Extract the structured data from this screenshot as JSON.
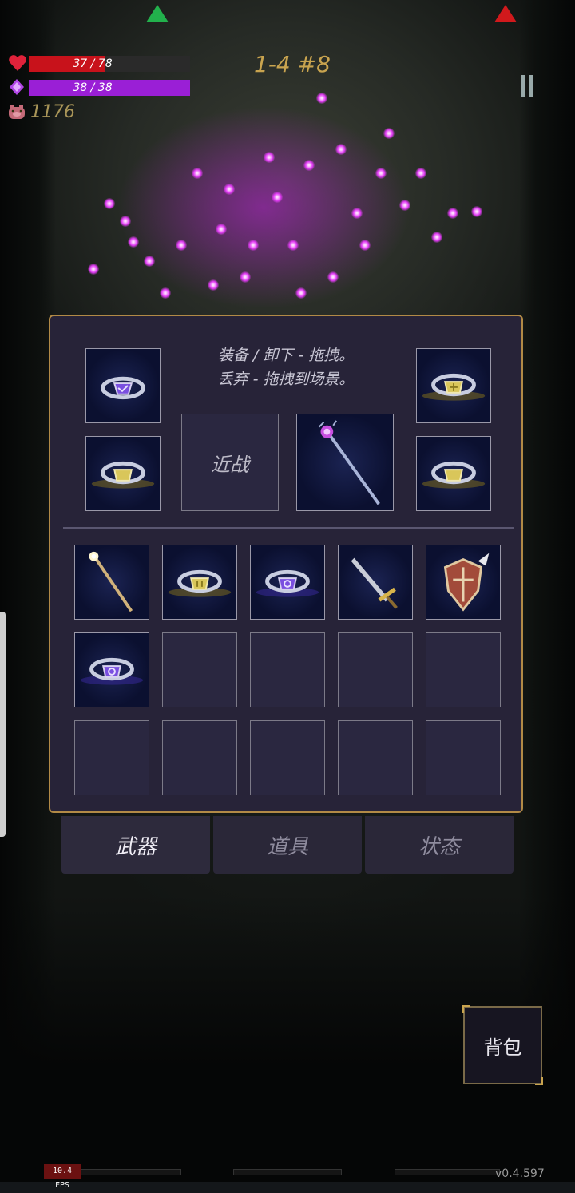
{
  "hud": {
    "hp_text": "37 / 78",
    "hp_fraction": 0.474,
    "mp_text": "38 / 38",
    "mp_fraction": 1.0,
    "coins": "1176",
    "stage": "1-4 #8",
    "colors": {
      "hp": "#c8121b",
      "mp": "#9a1fd6",
      "accent": "#c9a44f"
    }
  },
  "inventory": {
    "hint_line1": "装备 / 卸下 - 拖拽。",
    "hint_line2": "丢弃 - 拖拽到场景。",
    "melee_label": "近战",
    "equipped": {
      "ring_top_left": "ring-purple-icon",
      "ring_bottom_left": "ring-gold-icon",
      "weapon": "staff-icon",
      "ring_top_right": "ring-gold-icon",
      "ring_bottom_right": "ring-gold-icon"
    },
    "grid": [
      "wand-icon",
      "ring-gold-icon",
      "ring-purple-icon",
      "sword-icon",
      "shield-icon",
      "ring-purple-icon",
      "",
      "",
      "",
      "",
      "",
      "",
      "",
      "",
      ""
    ]
  },
  "tabs": [
    "武器",
    "道具",
    "状态"
  ],
  "active_tab": 0,
  "bag_button": "背包",
  "debug": {
    "fps": "10.4 FPS",
    "version": "v0.4.597"
  }
}
